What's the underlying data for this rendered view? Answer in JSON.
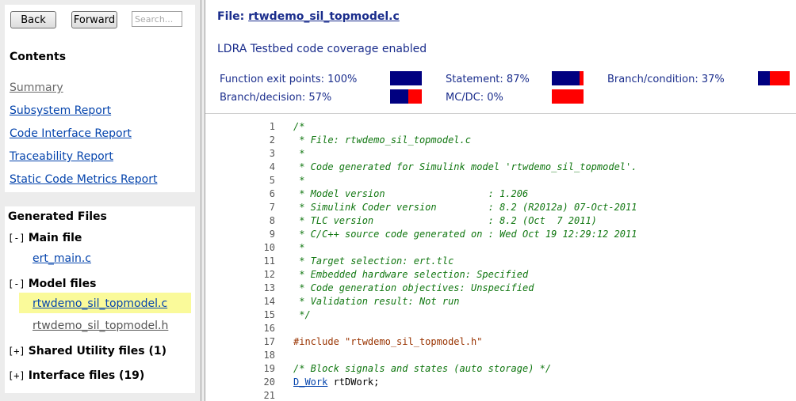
{
  "nav": {
    "back_label": "Back",
    "forward_label": "Forward",
    "search_placeholder": "Search...",
    "contents_title": "Contents",
    "links": [
      {
        "label": "Summary"
      },
      {
        "label": "Subsystem Report"
      },
      {
        "label": "Code Interface Report"
      },
      {
        "label": "Traceability Report"
      },
      {
        "label": "Static Code Metrics Report"
      }
    ]
  },
  "files": {
    "title": "Generated Files",
    "groups": [
      {
        "toggle": "[-]",
        "label": "Main file",
        "items": [
          "ert_main.c"
        ]
      },
      {
        "toggle": "[-]",
        "label": "Model files",
        "items": [
          "rtwdemo_sil_topmodel.c",
          "rtwdemo_sil_topmodel.h"
        ]
      },
      {
        "toggle": "[+]",
        "label": "Shared Utility files (1)"
      },
      {
        "toggle": "[+]",
        "label": "Interface files (19)"
      }
    ]
  },
  "content": {
    "file_prefix": "File: ",
    "file_name": "rtwdemo_sil_topmodel.c",
    "ldra_text": "LDRA Testbed code coverage enabled",
    "coverage": [
      {
        "label": "Function exit points: 100%",
        "percent": 100
      },
      {
        "label": "Statement: 87%",
        "percent": 87
      },
      {
        "label": "Branch/condition: 37%",
        "percent": 37
      },
      {
        "label": "Branch/decision: 57%",
        "percent": 57
      },
      {
        "label": "MC/DC: 0%",
        "percent": 0
      }
    ],
    "colors": {
      "covered": "#000080",
      "uncovered": "#ff0000",
      "heading": "#1a2d8c",
      "comment": "#117711",
      "preprocessor": "#993300",
      "highlight": "#fafa9a"
    },
    "code": [
      {
        "n": "1",
        "text": "/*",
        "kind": "comment"
      },
      {
        "n": "2",
        "text": " * File: rtwdemo_sil_topmodel.c",
        "kind": "comment"
      },
      {
        "n": "3",
        "text": " *",
        "kind": "comment"
      },
      {
        "n": "4",
        "text": " * Code generated for Simulink model 'rtwdemo_sil_topmodel'.",
        "kind": "comment"
      },
      {
        "n": "5",
        "text": " *",
        "kind": "comment"
      },
      {
        "n": "6",
        "text": " * Model version                  : 1.206",
        "kind": "comment"
      },
      {
        "n": "7",
        "text": " * Simulink Coder version         : 8.2 (R2012a) 07-Oct-2011",
        "kind": "comment"
      },
      {
        "n": "8",
        "text": " * TLC version                    : 8.2 (Oct  7 2011)",
        "kind": "comment"
      },
      {
        "n": "9",
        "text": " * C/C++ source code generated on : Wed Oct 19 12:29:12 2011",
        "kind": "comment"
      },
      {
        "n": "10",
        "text": " *",
        "kind": "comment"
      },
      {
        "n": "11",
        "text": " * Target selection: ert.tlc",
        "kind": "comment"
      },
      {
        "n": "12",
        "text": " * Embedded hardware selection: Specified",
        "kind": "comment"
      },
      {
        "n": "13",
        "text": " * Code generation objectives: Unspecified",
        "kind": "comment"
      },
      {
        "n": "14",
        "text": " * Validation result: Not run",
        "kind": "comment"
      },
      {
        "n": "15",
        "text": " */",
        "kind": "comment"
      },
      {
        "n": "16",
        "text": "",
        "kind": "plain"
      },
      {
        "n": "17",
        "text": "#include \"rtwdemo_sil_topmodel.h\"",
        "kind": "preproc"
      },
      {
        "n": "18",
        "text": "",
        "kind": "plain"
      },
      {
        "n": "19",
        "text": "/* Block signals and states (auto storage) */",
        "kind": "comment"
      },
      {
        "n": "20",
        "link": "D_Work",
        "text": " rtDWork;",
        "kind": "plain"
      },
      {
        "n": "21",
        "text": "",
        "kind": "plain"
      }
    ]
  }
}
